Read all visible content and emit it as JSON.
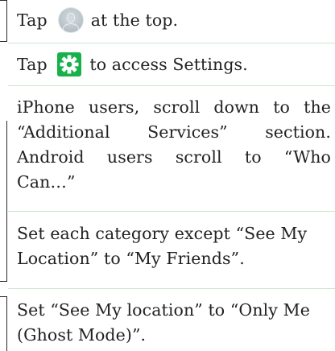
{
  "steps": [
    {
      "before": "Tap",
      "icon": "profile-avatar-icon",
      "after": "at the top."
    },
    {
      "before": "Tap",
      "icon": "settings-gear-icon",
      "after": "to access Settings."
    },
    {
      "lines": [
        [
          "iPhone",
          "users,",
          "scroll",
          "down",
          "to",
          "the"
        ],
        [
          "“Additional",
          "Services”",
          "section."
        ],
        [
          "Android",
          "users",
          "scroll",
          "to",
          "“Who"
        ],
        [
          "Can…”"
        ]
      ]
    },
    {
      "line1": "Set each category except “See My",
      "line2": "Location” to “My Friends”."
    },
    {
      "line1": "Set “See My location” to “Only Me",
      "line2": "(Ghost Mode)”."
    }
  ],
  "colors": {
    "gear_background": "#16b14a",
    "divider": "#c9e6cf",
    "text": "#222222"
  }
}
